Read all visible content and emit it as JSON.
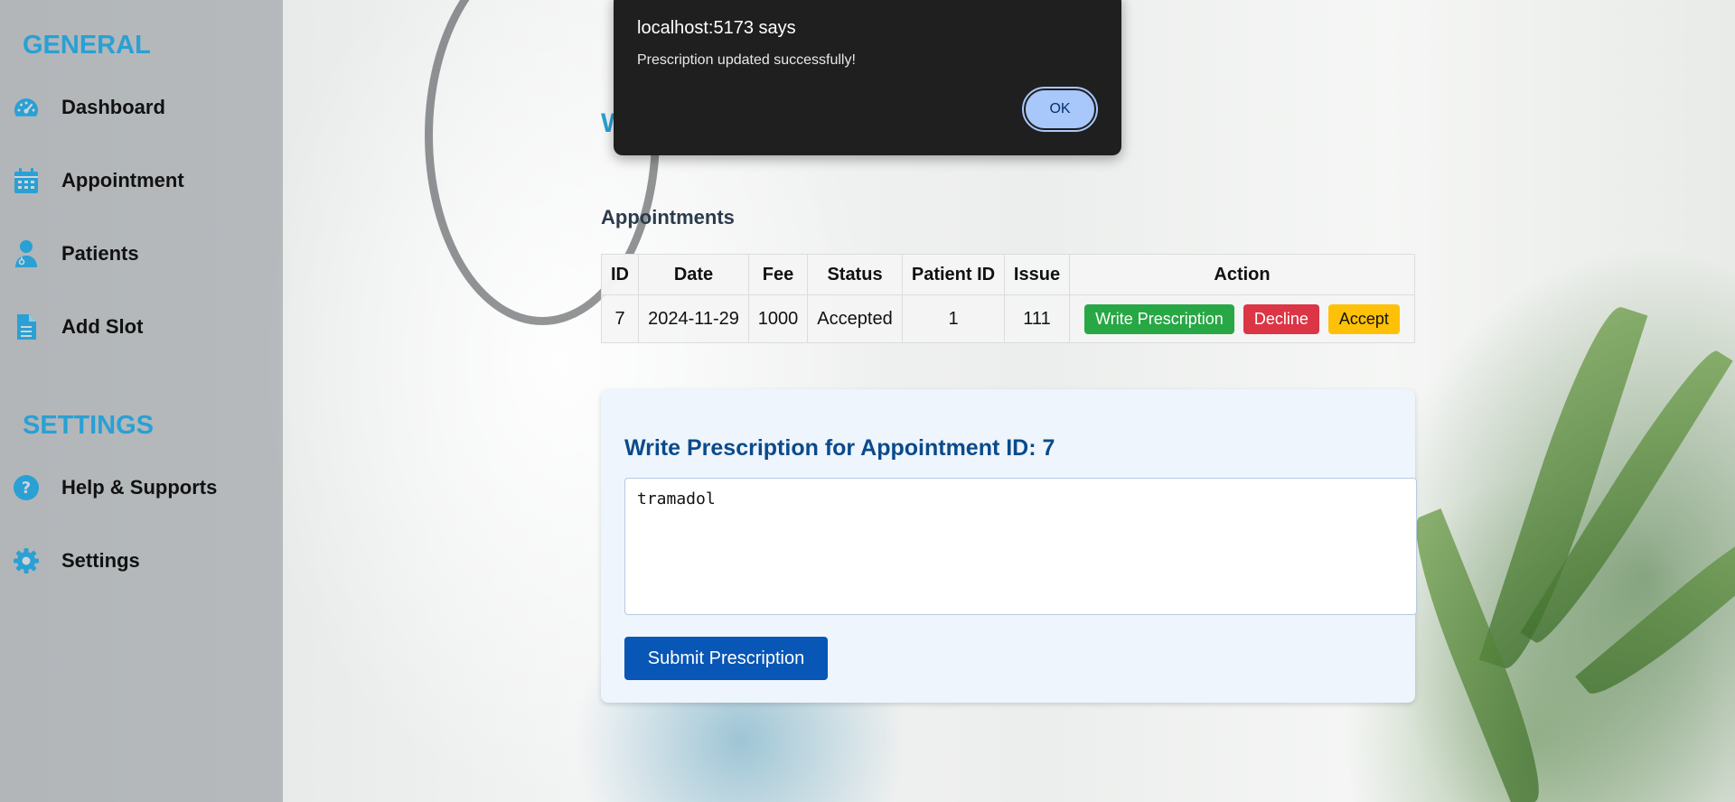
{
  "sidebar": {
    "general_title": "GENERAL",
    "settings_title": "SETTINGS",
    "general_items": [
      {
        "label": "Dashboard",
        "icon": "gauge-icon"
      },
      {
        "label": "Appointment",
        "icon": "calendar-icon"
      },
      {
        "label": "Patients",
        "icon": "user-doctor-icon"
      },
      {
        "label": "Add Slot",
        "icon": "document-icon"
      }
    ],
    "settings_items": [
      {
        "label": "Help & Supports",
        "icon": "question-circle-icon"
      },
      {
        "label": "Settings",
        "icon": "gear-icon"
      }
    ],
    "accent_color": "#2aa0d4"
  },
  "main": {
    "heading_partial": "W",
    "appointments_title": "Appointments",
    "table": {
      "headers": [
        "ID",
        "Date",
        "Fee",
        "Status",
        "Patient ID",
        "Issue",
        "Action"
      ],
      "rows": [
        {
          "id": "7",
          "date": "2024-11-29",
          "fee": "1000",
          "status": "Accepted",
          "patient_id": "1",
          "issue": "111",
          "actions": [
            "Write Prescription",
            "Decline",
            "Accept"
          ]
        }
      ]
    },
    "prescription": {
      "title": "Write Prescription for Appointment ID: 7",
      "text": "tramadol",
      "submit_label": "Submit Prescription"
    }
  },
  "dialog": {
    "title": "localhost:5173 says",
    "message": "Prescription updated successfully!",
    "ok_label": "OK"
  },
  "colors": {
    "write_prescription": "#28a745",
    "decline": "#dc3545",
    "accept": "#ffc107",
    "submit": "#0856b6",
    "prescription_title": "#0a4a8c"
  }
}
